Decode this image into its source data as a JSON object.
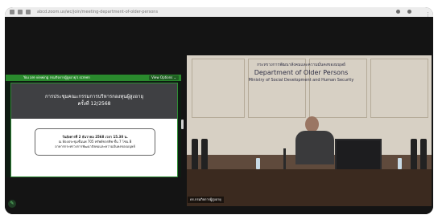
{
  "browser": {
    "url": "abcd.zoom.us/wc/join/meeting-department-of-older-persons"
  },
  "share_panel": {
    "viewing_text": "You are viewing กรมกิจการผู้สูงอายุ's screen",
    "view_options_label": "View Options ⌄",
    "slide": {
      "title_line1": "การประชุมคณะกรรมการบริหารกองทุนผู้สูงอายุ",
      "title_line2": "ครั้งที่ 12/2568",
      "date_line": "วันอังคารที่ 2 ธันวาคม 2568 เวลา 15.30 น.",
      "room_line": "ณ ห้องประชุมชั้นนพ 705 ทรัพย์ขจรทิพ ชั้น 7 โซน B",
      "building_line": "อาคารกระทรวงการพัฒนาสังคมและความมั่นคงของมนุษย์"
    }
  },
  "video": {
    "banner_th": "กระทรวงการพัฒนาสังคมและความมั่นคงของมนุษย์",
    "banner_en_dept": "Department of Older Persons",
    "banner_en_ministry": "Ministry of Social Development and Human Security",
    "participant_name": "ดร.กรมกิจการผู้สูงอายุ"
  },
  "icons": {
    "chat": "chat-icon",
    "more": "more-options-icon"
  },
  "colors": {
    "viewing_bar": "#2a8a2d",
    "slide_header": "#3f4043"
  }
}
